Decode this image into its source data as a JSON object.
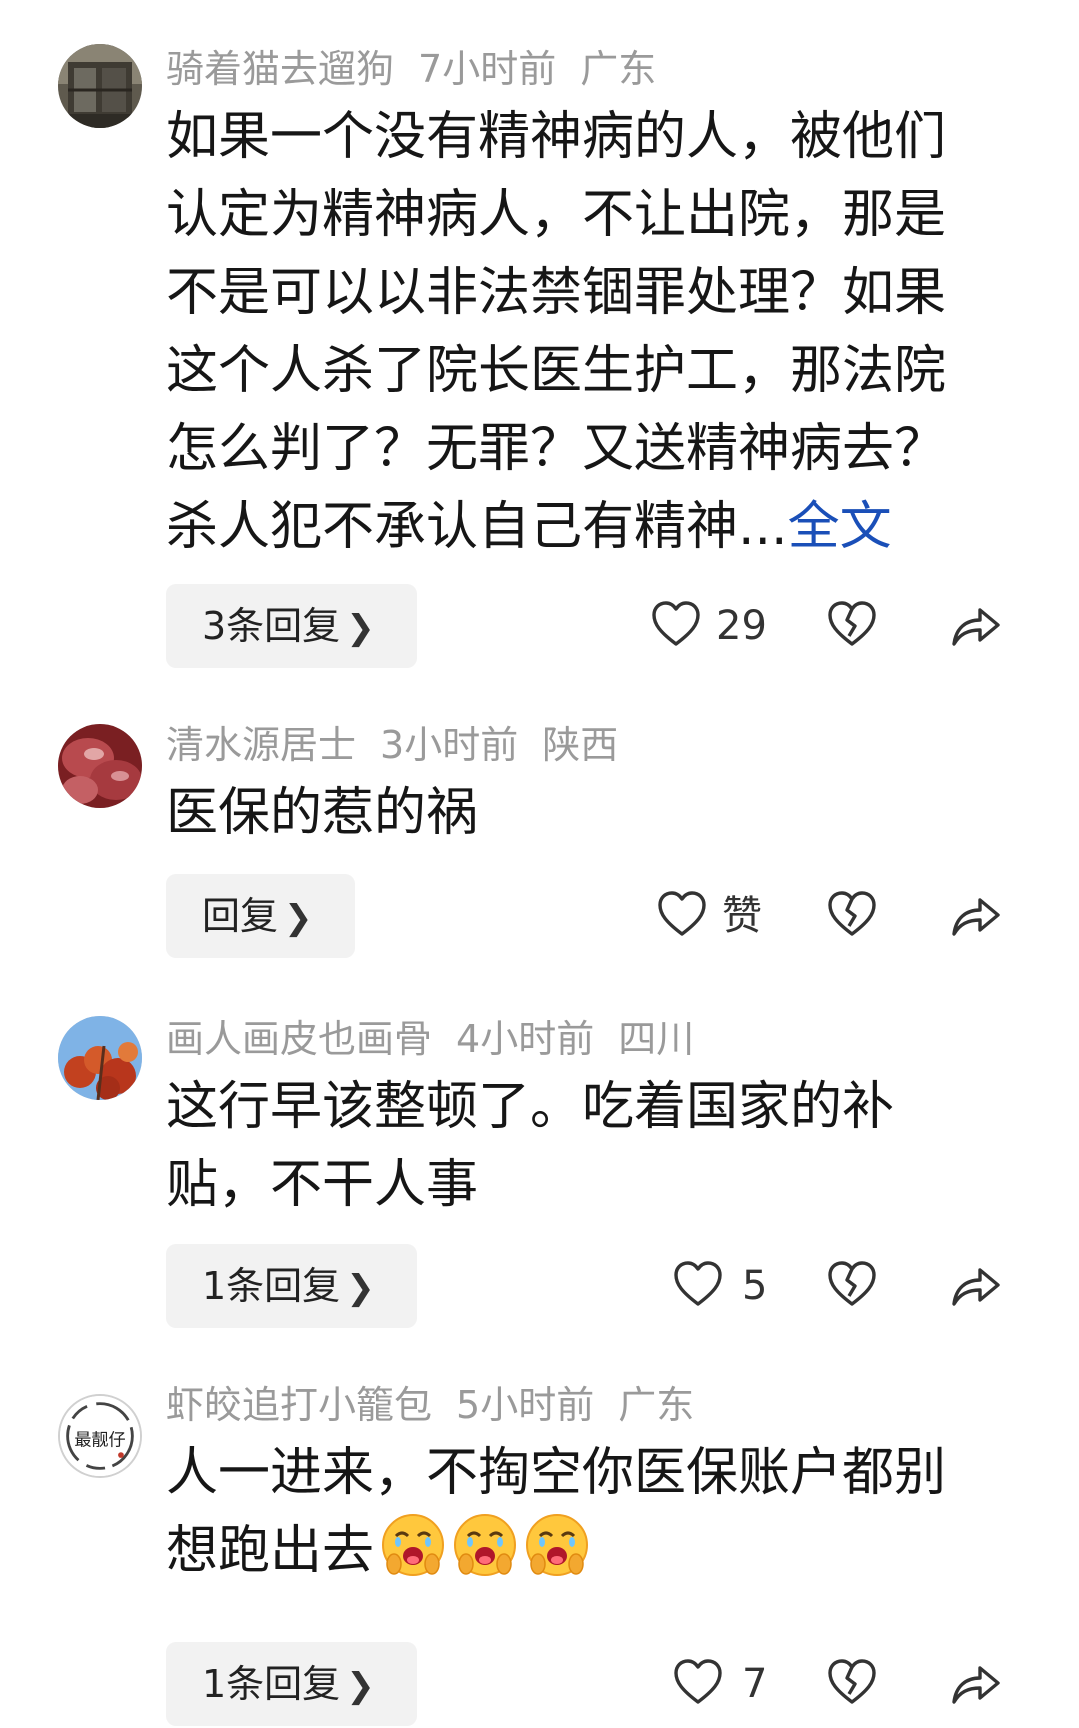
{
  "comments": [
    {
      "username": "骑着猫去遛狗",
      "time": "7小时前",
      "location": "广东",
      "text": "如果一个没有精神病的人，被他们认定为精神病人，不让出院，那是不是可以以非法禁锢罪处理？如果这个人杀了院长医生护工，那法院怎么判了？无罪？又送精神病去？杀人犯不承认自己有精神...",
      "more_label": "全文",
      "reply_label": "3条回复",
      "like_count": "29"
    },
    {
      "username": "清水源居士",
      "time": "3小时前",
      "location": "陕西",
      "text": "医保的惹的祸",
      "reply_label": "回复",
      "like_count": "赞"
    },
    {
      "username": "画人画皮也画骨",
      "time": "4小时前",
      "location": "四川",
      "text": "这行早该整顿了。吃着国家的补贴，不干人事",
      "reply_label": "1条回复",
      "like_count": "5"
    },
    {
      "username": "虾皎追打小籠包",
      "time": "5小时前",
      "location": "广东",
      "text": "人一进来，不掏空你医保账户都别想跑出去",
      "emojis": [
        "crying-laughing-emoji",
        "crying-laughing-emoji",
        "crying-laughing-emoji"
      ],
      "avatar_text": "最靓仔",
      "reply_label": "1条回复",
      "like_count": "7"
    }
  ],
  "icons": {
    "reply_chevron": "chevron-right-icon",
    "like": "heart-outline-icon",
    "dislike": "broken-heart-icon",
    "share": "share-arrow-icon"
  },
  "colors": {
    "meta_text": "#9a9a9a",
    "link_blue": "#1a4fb8",
    "reply_bg": "#f2f2f2"
  }
}
